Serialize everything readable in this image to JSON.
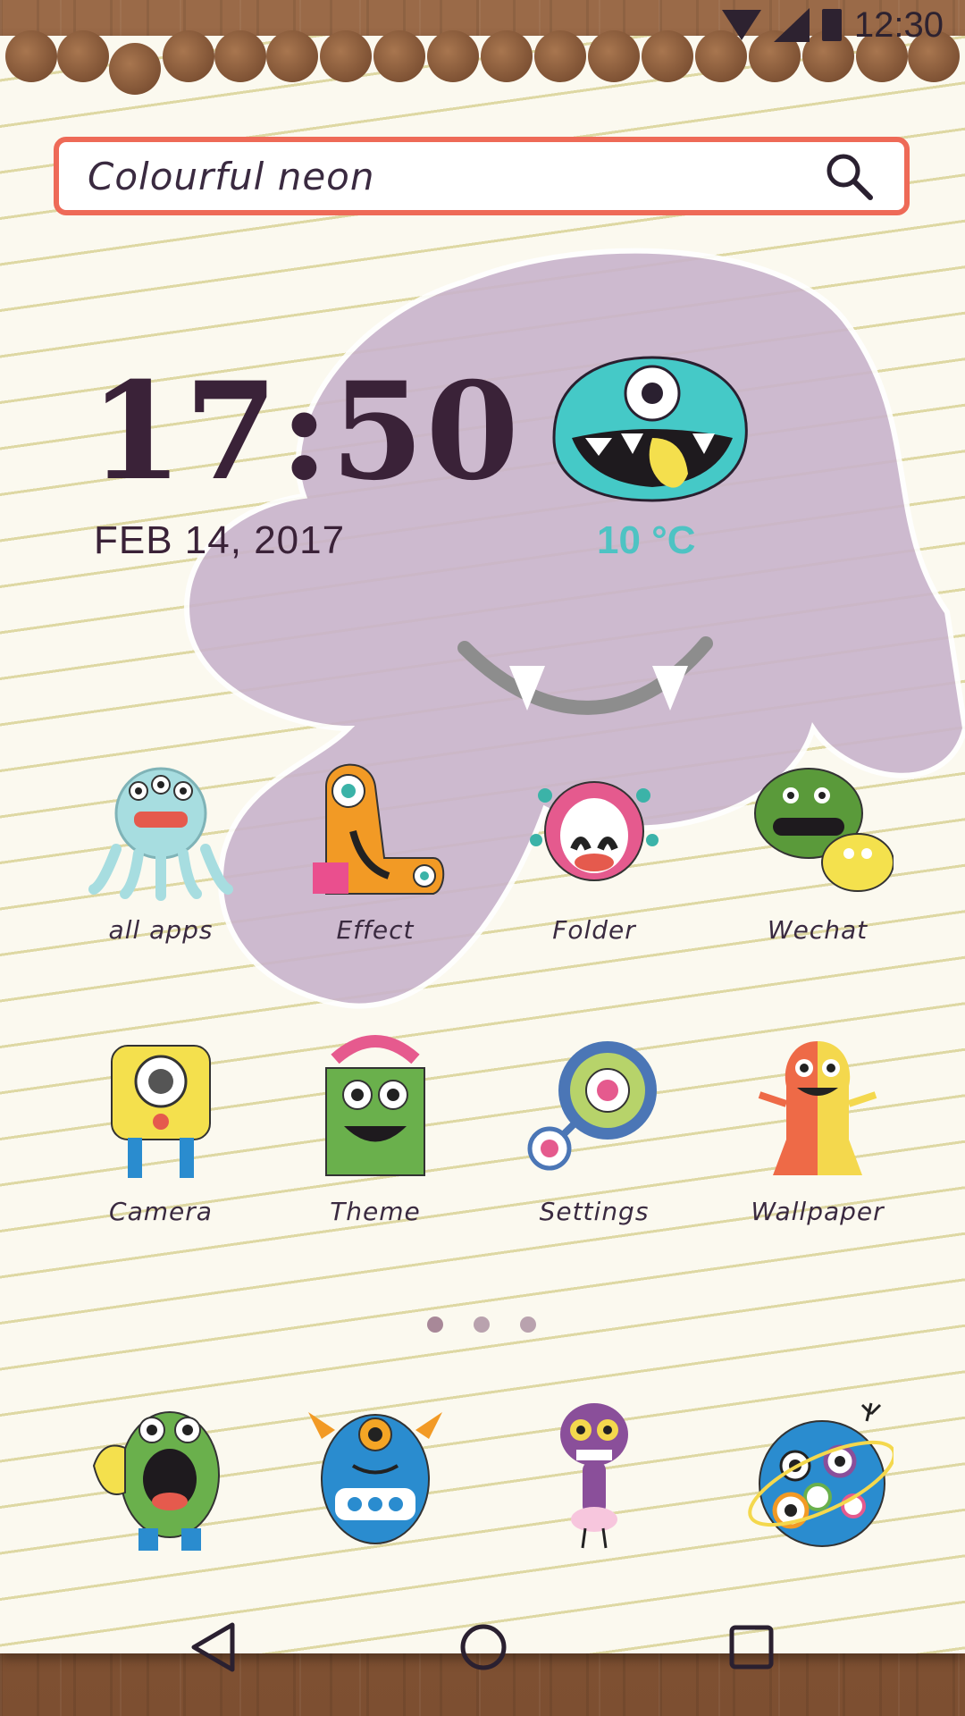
{
  "status_bar": {
    "time": "12:30"
  },
  "search": {
    "text": "Colourful neon",
    "icon": "search-icon"
  },
  "clock": {
    "time": "17:50",
    "date": "FEB 14,  2017"
  },
  "weather": {
    "temperature": "10 °C",
    "icon": "monster-weather-icon"
  },
  "apps_row1": [
    {
      "label": "all apps",
      "icon": "octopus-monster-icon"
    },
    {
      "label": "Effect",
      "icon": "boot-monster-icon"
    },
    {
      "label": "Folder",
      "icon": "pink-monster-icon"
    },
    {
      "label": "Wechat",
      "icon": "green-blob-monster-icon"
    }
  ],
  "apps_row2": [
    {
      "label": "Camera",
      "icon": "camera-monster-icon"
    },
    {
      "label": "Theme",
      "icon": "green-theme-monster-icon"
    },
    {
      "label": "Settings",
      "icon": "gear-monster-icon"
    },
    {
      "label": "Wallpaper",
      "icon": "two-tone-monster-icon"
    }
  ],
  "dock": [
    {
      "icon": "phone-monster-icon"
    },
    {
      "icon": "message-monster-icon"
    },
    {
      "icon": "purple-alien-icon"
    },
    {
      "icon": "planet-monster-icon"
    }
  ],
  "page_indicator": {
    "pages": 3,
    "current": 1
  },
  "navigation": {
    "back": "back-icon",
    "home": "home-icon",
    "recents": "recents-icon"
  },
  "colors": {
    "search_border": "#ee6a57",
    "temp": "#4ec3c3",
    "text": "#3a2238"
  }
}
